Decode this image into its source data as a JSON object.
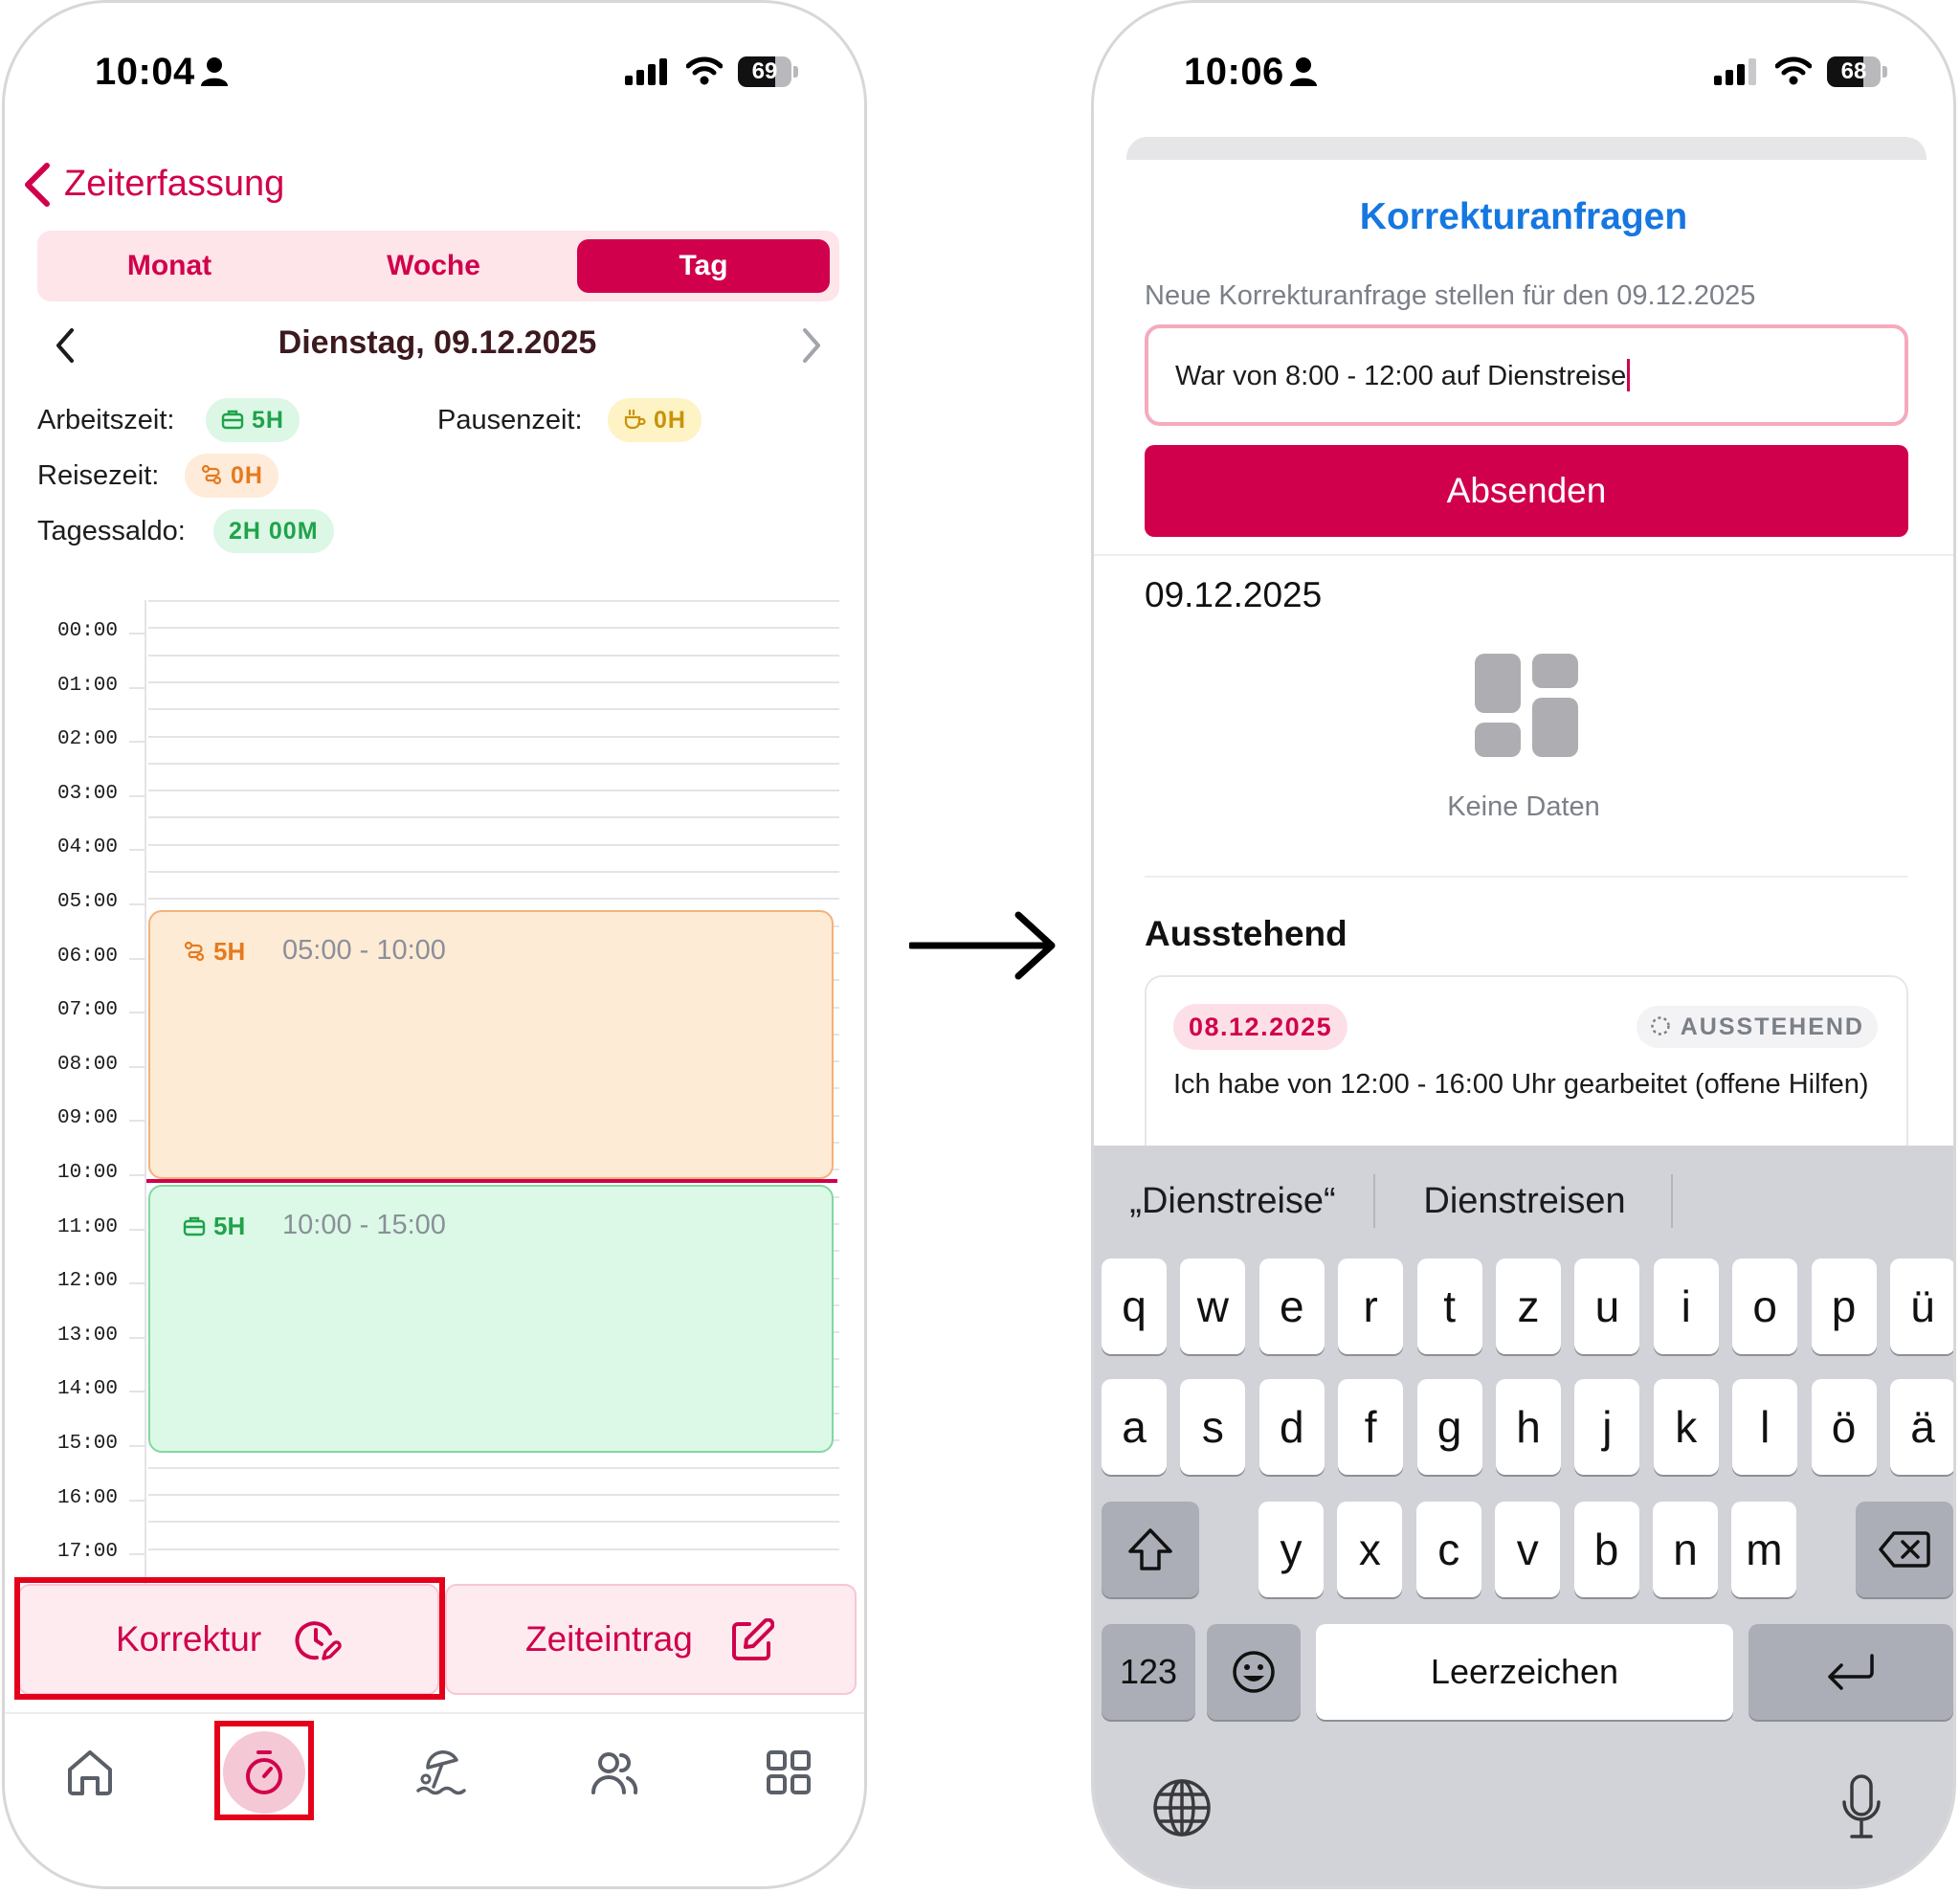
{
  "left": {
    "status": {
      "time": "10:04",
      "battery": "69",
      "battery_level": 0.69
    },
    "header": {
      "back_label": "Zeiterfassung"
    },
    "tabs": [
      {
        "label": "Monat",
        "active": false
      },
      {
        "label": "Woche",
        "active": false
      },
      {
        "label": "Tag",
        "active": true
      }
    ],
    "date_title": "Dienstag, 09.12.2025",
    "stats": {
      "work_label": "Arbeitszeit:",
      "work_value": "5H",
      "break_label": "Pausenzeit:",
      "break_value": "0H",
      "travel_label": "Reisezeit:",
      "travel_value": "0H",
      "balance_label": "Tagessaldo:",
      "balance_value": "2H 00M"
    },
    "hours": [
      "00:00",
      "01:00",
      "02:00",
      "03:00",
      "04:00",
      "05:00",
      "06:00",
      "07:00",
      "08:00",
      "09:00",
      "10:00",
      "11:00",
      "12:00",
      "13:00",
      "14:00",
      "15:00",
      "16:00",
      "17:00"
    ],
    "events": [
      {
        "type": "travel",
        "duration": "5H",
        "range": "05:00 - 10:00"
      },
      {
        "type": "work",
        "duration": "5H",
        "range": "10:00 - 15:00"
      }
    ],
    "actions": {
      "korrektur": "Korrektur",
      "zeiteintrag": "Zeiteintrag"
    },
    "colors": {
      "accent": "#d1004c",
      "highlight": "#e4001b"
    }
  },
  "right": {
    "status": {
      "time": "10:06",
      "battery": "68",
      "battery_level": 0.68
    },
    "title": "Korrekturanfragen",
    "subtitle": "Neue Korrekturanfrage stellen für den 09.12.2025",
    "input_value": "War von 8:00 - 12:00 auf Dienstreise",
    "submit_label": "Absenden",
    "section_date": "09.12.2025",
    "empty_text": "Keine Daten",
    "pending_title": "Ausstehend",
    "card": {
      "date": "08.12.2025",
      "status": "AUSSTEHEND",
      "text": "Ich habe von 12:00 - 16:00 Uhr gearbeitet (offene Hilfen)"
    },
    "keyboard": {
      "suggestions": [
        "„Dienstreise“",
        "Dienstreisen"
      ],
      "row1": [
        "q",
        "w",
        "e",
        "r",
        "t",
        "z",
        "u",
        "i",
        "o",
        "p",
        "ü"
      ],
      "row2": [
        "a",
        "s",
        "d",
        "f",
        "g",
        "h",
        "j",
        "k",
        "l",
        "ö",
        "ä"
      ],
      "row3": [
        "y",
        "x",
        "c",
        "v",
        "b",
        "n",
        "m"
      ],
      "numbers_label": "123",
      "space_label": "Leerzeichen"
    },
    "colors": {
      "title": "#1677e0"
    }
  }
}
